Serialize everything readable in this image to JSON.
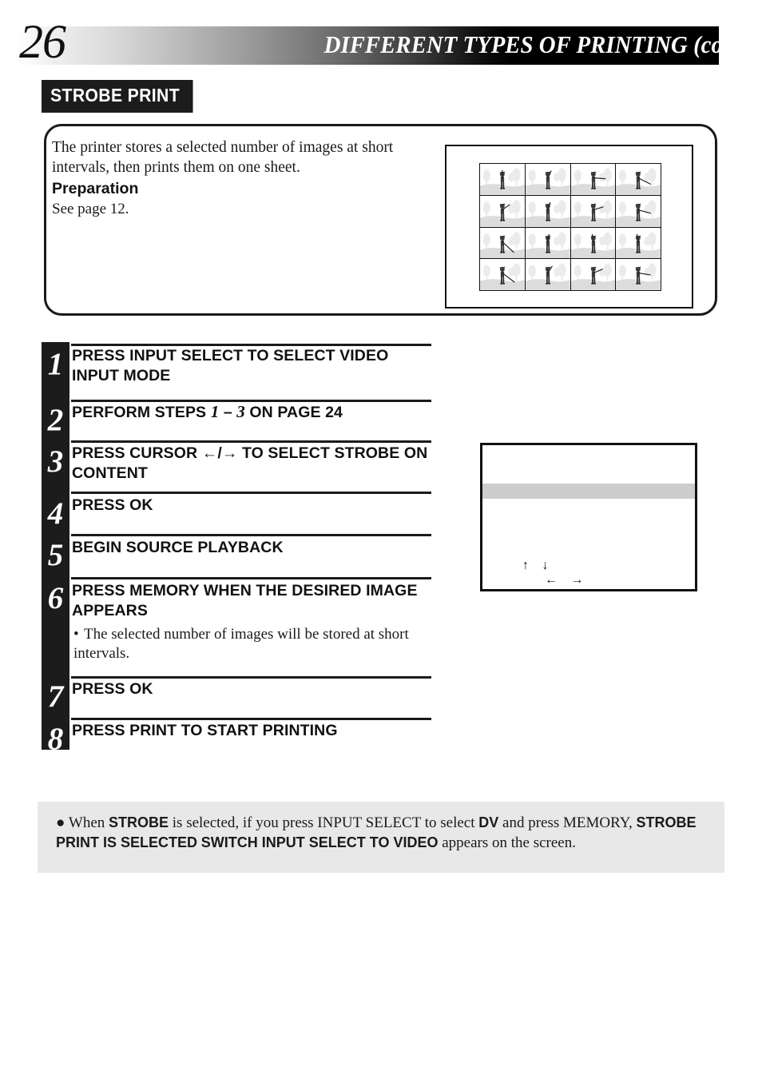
{
  "header": {
    "page_number": "26",
    "title": "DIFFERENT TYPES OF PRINTING (cont.)"
  },
  "section": {
    "tag": "STROBE PRINT"
  },
  "intro": {
    "description": "The printer stores a selected number of images at short intervals, then prints them on one sheet.",
    "preparation_heading": "Preparation",
    "preparation_text": "See page 12."
  },
  "illustration": {
    "name": "strobe-print-sample-sheet",
    "rows": 4,
    "cols": 4,
    "frames": 16,
    "subject": "baseball batter swing sequence"
  },
  "steps": [
    {
      "number": "1",
      "title": "PRESS INPUT SELECT TO SELECT VIDEO INPUT MODE"
    },
    {
      "number": "2",
      "title_pre": "PERFORM STEPS ",
      "title_i1": "1",
      "title_dash": " – ",
      "title_i2": "3",
      "title_post": " ON PAGE 24"
    },
    {
      "number": "3",
      "title": "PRESS CURSOR ←/→ TO SELECT STROBE ON CONTENT"
    },
    {
      "number": "4",
      "title": "PRESS OK"
    },
    {
      "number": "5",
      "title": "BEGIN SOURCE PLAYBACK"
    },
    {
      "number": "6",
      "title": "PRESS MEMORY WHEN THE DESIRED IMAGE APPEARS",
      "note": "The selected number of images will be stored at short intervals."
    },
    {
      "number": "7",
      "title": "PRESS OK"
    },
    {
      "number": "8",
      "title": "PRESS PRINT TO START PRINTING"
    }
  ],
  "menu_screen": {
    "name": "on-screen-menu-preview",
    "arrows_up_down": "↑ ↓",
    "arrows_left_right": "← →"
  },
  "footnote": {
    "bullet": "●",
    "part1": "When ",
    "bold1": "STROBE",
    "part2": " is selected, if you press INPUT SELECT to select ",
    "bold2": "DV",
    "part3": " and press MEMORY, ",
    "bold3": "STROBE PRINT IS SELECTED",
    "gap": "    ",
    "bold4": "SWITCH INPUT SELECT TO VIDEO",
    "part4": " appears on the screen."
  },
  "colors": {
    "ink": "#1a1a1a",
    "bar_black": "#000000",
    "footnote_bg": "#e8e8e8",
    "menu_highlight": "#cdcdcd"
  }
}
